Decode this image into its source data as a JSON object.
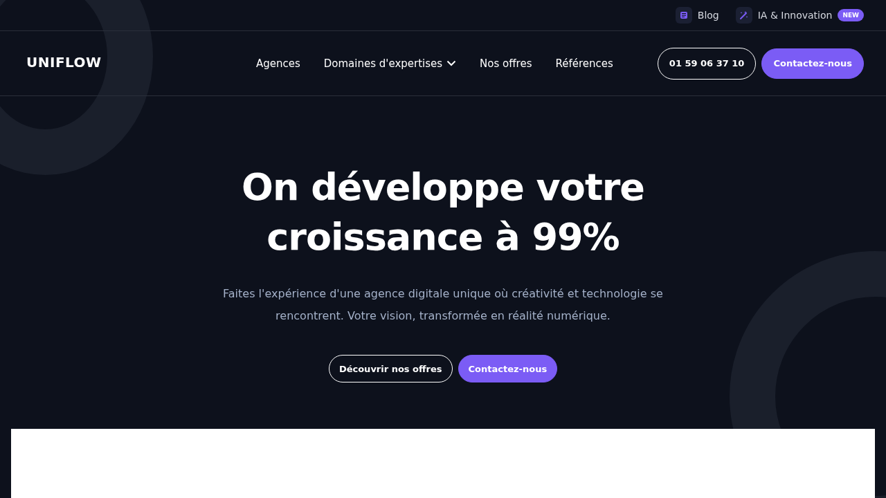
{
  "topbar": {
    "links": [
      {
        "kind": "blog",
        "label": "Blog"
      },
      {
        "kind": "ai",
        "label": "IA & Innovation",
        "badge": "NEW"
      }
    ]
  },
  "header": {
    "logo": "UNIFLOW",
    "nav": [
      {
        "label": "Agences",
        "dropdown": false
      },
      {
        "label": "Domaines d'expertises",
        "dropdown": true
      },
      {
        "label": "Nos offres",
        "dropdown": false
      },
      {
        "label": "Références",
        "dropdown": false
      }
    ],
    "phone": "01 59 06 37 10",
    "contact": "Contactez-nous"
  },
  "hero": {
    "title": "On développe votre croissance à 99%",
    "subtitle": "Faites l'expérience d'une agence digitale unique où créativité et technologie se rencontrent. Votre vision, transformée en réalité numérique.",
    "buttons": [
      {
        "kind": "outline",
        "label": "Découvrir nos offres"
      },
      {
        "kind": "primary",
        "label": "Contactez-nous"
      }
    ]
  }
}
